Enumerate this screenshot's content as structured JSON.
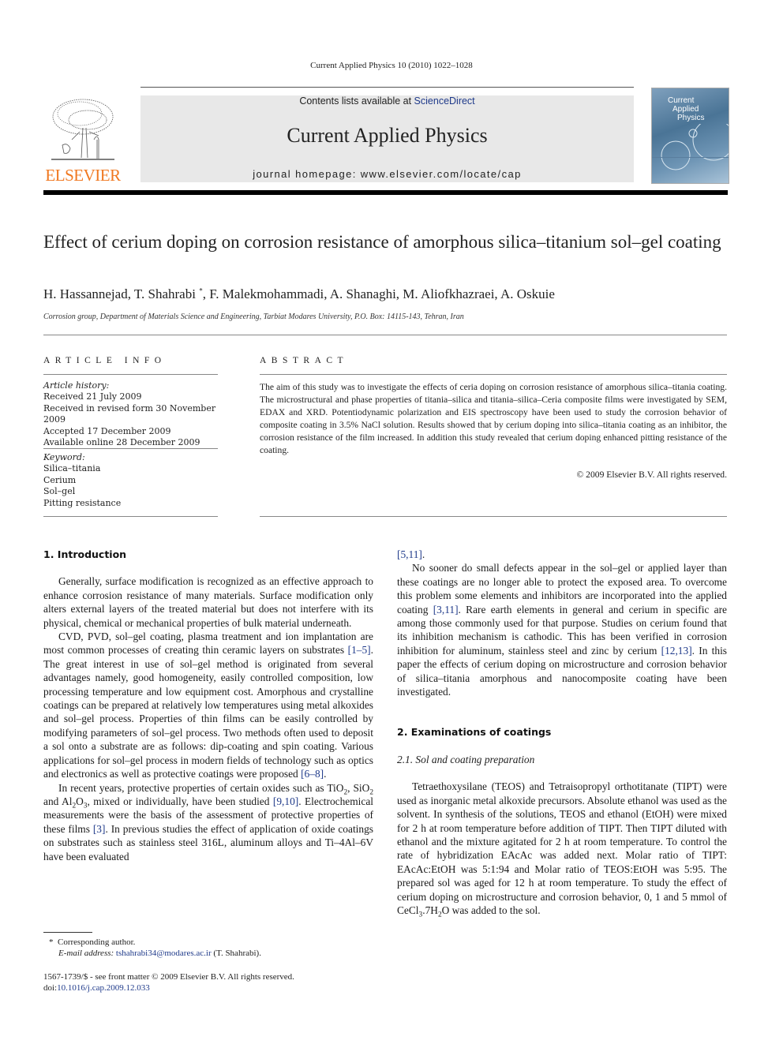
{
  "running_head": "Current Applied Physics 10 (2010) 1022–1028",
  "header": {
    "publisher_logo_text": "ELSEVIER",
    "contents_prefix": "Contents lists available at ",
    "contents_link": "ScienceDirect",
    "journal_title": "Current Applied Physics",
    "homepage": "journal homepage: www.elsevier.com/locate/cap",
    "cover": {
      "line1": "Current",
      "line2": "Applied",
      "line3": "Physics"
    },
    "colors": {
      "elsevier_orange": "#f07820",
      "link_blue": "#1f3a8a",
      "banner_gray": "#e8e8e8"
    }
  },
  "article": {
    "title": "Effect of cerium doping on corrosion resistance of amorphous silica–titanium sol–gel coating",
    "authors_before_star": "H. Hassannejad, T. Shahrabi ",
    "author_star": "*",
    "authors_after_star": ", F. Malekmohammadi, A. Shanaghi, M. Aliofkhazraei, A. Oskuie",
    "affiliation": "Corrosion group, Department of Materials Science and Engineering, Tarbiat Modares University, P.O. Box: 14115-143, Tehran, Iran"
  },
  "article_info": {
    "heading": "ARTICLE INFO",
    "history_label": "Article history:",
    "history": [
      "Received 21 July 2009",
      "Received in revised form 30 November 2009",
      "Accepted 17 December 2009",
      "Available online 28 December 2009"
    ],
    "keyword_label": "Keyword:",
    "keywords": [
      "Silica–titania",
      "Cerium",
      "Sol–gel",
      "Pitting resistance"
    ]
  },
  "abstract": {
    "heading": "ABSTRACT",
    "text": "The aim of this study was to investigate the effects of ceria doping on corrosion resistance of amorphous silica–titania coating. The microstructural and phase properties of titania–silica and titania–silica–Ceria composite films were investigated by SEM, EDAX and XRD. Potentiodynamic polarization and EIS spectroscopy have been used to study the corrosion behavior of composite coating in 3.5% NaCl solution. Results showed that by cerium doping into silica–titania coating as an inhibitor, the corrosion resistance of the film increased. In addition this study revealed that cerium doping enhanced pitting resistance of the coating.",
    "copyright": "© 2009 Elsevier B.V. All rights reserved."
  },
  "body": {
    "sec1_heading": "1. Introduction",
    "p1": "Generally, surface modification is recognized as an effective approach to enhance corrosion resistance of many materials. Surface modification only alters external layers of the treated material but does not interfere with its physical, chemical or mechanical properties of bulk material underneath.",
    "p2a": "CVD, PVD, sol–gel coating, plasma treatment and ion implantation are most common processes of creating thin ceramic layers on substrates ",
    "p2_ref1": "[1–5]",
    "p2b": ". The great interest in use of sol–gel method is originated from several advantages namely, good homogeneity, easily controlled composition, low processing temperature and low equipment cost. Amorphous and crystalline coatings can be prepared at relatively low temperatures using metal alkoxides and sol–gel process. Properties of thin films can be easily controlled by modifying parameters of sol–gel process. Two methods often used to deposit a sol onto a substrate are as follows: dip-coating and spin coating. Various applications for sol–gel process in modern fields of technology such as optics and electronics as well as protective coatings were proposed ",
    "p2_ref2": "[6–8]",
    "p2c": ".",
    "p3a": "In recent years, protective properties of certain oxides such as ",
    "p3_tio": "TiO",
    "p3_sio": "SiO",
    "p3_al": "Al",
    "p3_o": "O",
    "sub2": "2",
    "sub3": "3",
    "p3_mid": ", mixed or individually, have been studied ",
    "p3_ref1": "[9,10]",
    "p3b": ". Electrochemical measurements were the basis of the assessment of protective properties of these films ",
    "p3_ref2": "[3]",
    "p3c": ". In previous studies the effect of application of oxide coatings on substrates such as stainless steel 316L, aluminum alloys and Ti–4Al–6V have been evaluated ",
    "p3_ref3": "[5,11]",
    "p4a": "No sooner do small defects appear in the sol–gel or applied layer than these coatings are no longer able to protect the exposed area. To overcome this problem some elements and inhibitors are incorporated into the applied coating ",
    "p4_ref1": "[3,11]",
    "p4b": ". Rare earth elements in general and cerium in specific are among those commonly used for that purpose. Studies on cerium found that its inhibition mechanism is cathodic. This has been verified in corrosion inhibition for aluminum, stainless steel and zinc by cerium ",
    "p4_ref2": "[12,13]",
    "p4c": ". In this paper the effects of cerium doping on microstructure and corrosion behavior of silica–titania amorphous and nanocomposite coating have been investigated.",
    "sec2_heading": "2. Examinations of coatings",
    "sec21_heading": "2.1. Sol and coating preparation",
    "p5a": "Tetraethoxysilane (TEOS) and Tetraisopropyl orthotitanate (TIPT) were used as inorganic metal alkoxide precursors. Absolute ethanol was used as the solvent. In synthesis of the solutions, TEOS and ethanol (EtOH) were mixed for 2 h at room temperature before addition of TIPT. Then TIPT diluted with ethanol and the mixture agitated for 2 h at room temperature. To control the rate of hybridization EAcAc was added next. Molar ratio of TIPT: EAcAc:EtOH was 5:1:94 and Molar ratio of TEOS:EtOH was 5:95. The prepared sol was aged for 12 h at room temperature. To study the effect of cerium doping on microstructure and corrosion behavior, 0, 1 and 5 mmol of CeCl",
    "p5_sub3": "3",
    "p5_mid": ".7H",
    "p5_sub2": "2",
    "p5b": "O was added to the sol."
  },
  "footnotes": {
    "star": "*",
    "corresponding": "Corresponding author.",
    "email_label": "E-mail address:",
    "email": "tshahrabi34@modares.ac.ir",
    "email_suffix": " (T. Shahrabi).",
    "front_matter": "1567-1739/$ - see front matter © 2009 Elsevier B.V. All rights reserved.",
    "doi_prefix": "doi:",
    "doi": "10.1016/j.cap.2009.12.033"
  }
}
